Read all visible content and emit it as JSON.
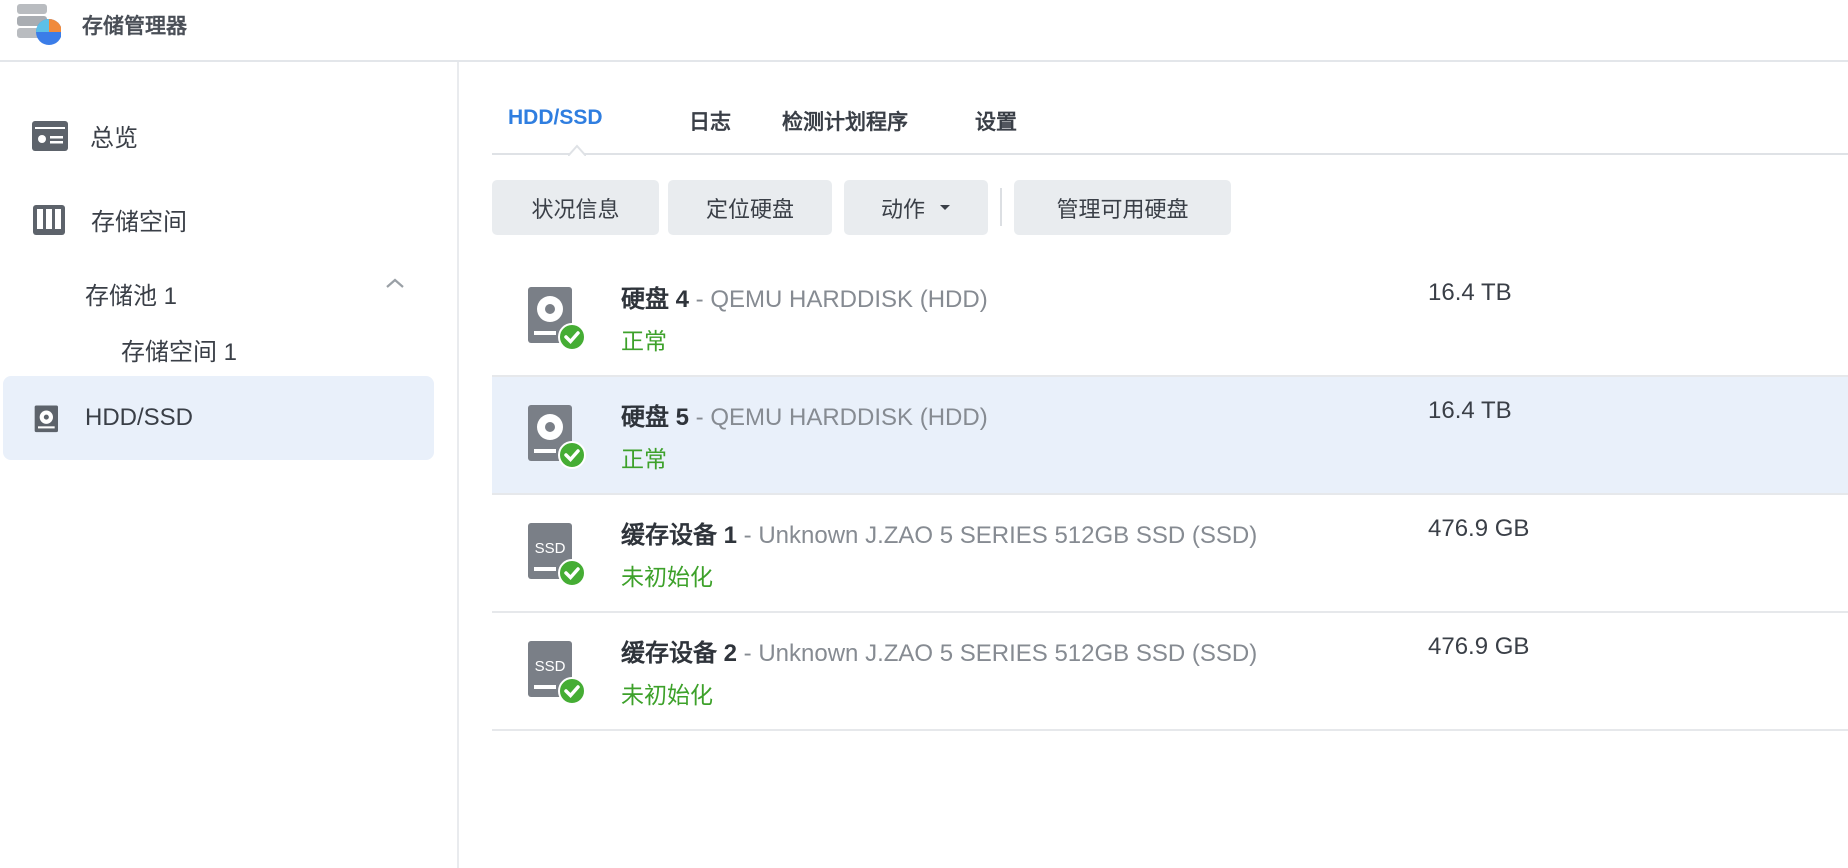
{
  "app": {
    "title": "存储管理器"
  },
  "sidebar": {
    "items": [
      {
        "label": "总览"
      },
      {
        "label": "存储空间"
      },
      {
        "label": "存储池 1"
      },
      {
        "label": "存储空间 1"
      },
      {
        "label": "HDD/SSD"
      }
    ]
  },
  "tabs": [
    {
      "label": "HDD/SSD"
    },
    {
      "label": "日志"
    },
    {
      "label": "检测计划程序"
    },
    {
      "label": "设置"
    }
  ],
  "toolbar": {
    "status_info": "状况信息",
    "locate": "定位硬盘",
    "action": "动作",
    "manage": "管理可用硬盘"
  },
  "disks": [
    {
      "name": "硬盘 4",
      "model": " - QEMU HARDDISK (HDD)",
      "status": "正常",
      "size": "16.4 TB",
      "type": "HDD"
    },
    {
      "name": "硬盘 5",
      "model": " - QEMU HARDDISK (HDD)",
      "status": "正常",
      "size": "16.4 TB",
      "type": "HDD"
    },
    {
      "name": "缓存设备 1",
      "model": " - Unknown J.ZAO 5 SERIES 512GB SSD (SSD)",
      "status": "未初始化",
      "size": "476.9 GB",
      "type": "SSD"
    },
    {
      "name": "缓存设备 2",
      "model": " - Unknown J.ZAO 5 SERIES 512GB SSD (SSD)",
      "status": "未初始化",
      "size": "476.9 GB",
      "type": "SSD"
    }
  ],
  "colors": {
    "accent": "#2f7ee0",
    "ok": "#3da12a",
    "selected": "#e9f0fa"
  }
}
